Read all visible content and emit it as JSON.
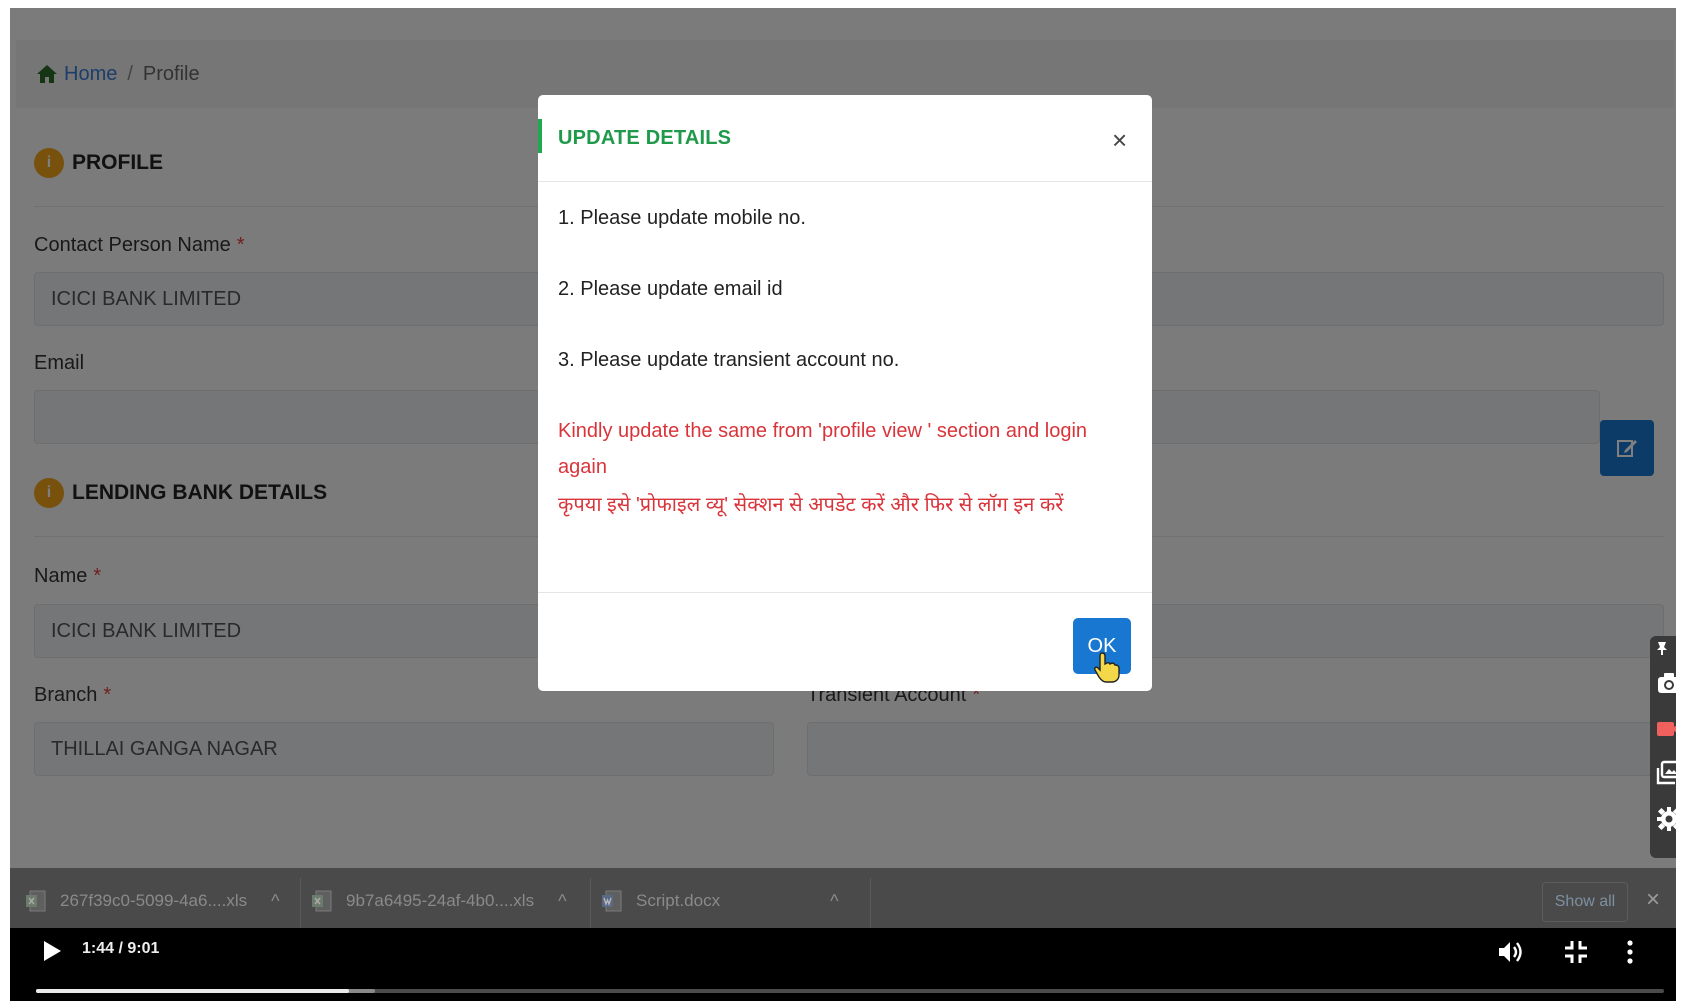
{
  "breadcrumb": {
    "home": "Home",
    "separator": "/",
    "current": "Profile"
  },
  "profile": {
    "section_badge": "i",
    "section_title": "PROFILE",
    "contact_label": "Contact Person Name",
    "contact_value": "ICICI BANK LIMITED",
    "email_label": "Email",
    "email_value": ""
  },
  "lending": {
    "section_badge": "i",
    "section_title": "LENDING BANK DETAILS",
    "name_label": "Name",
    "name_value": "ICICI BANK LIMITED",
    "branch_label": "Branch",
    "branch_value": "THILLAI GANGA NAGAR",
    "transient_label": "Transient Account",
    "transient_value": ""
  },
  "required_mark": "*",
  "modal": {
    "title": "UPDATE DETAILS",
    "close": "×",
    "lines": [
      "1. Please update mobile no.",
      "2. Please update email id",
      "3. Please update transient account no."
    ],
    "notice_en_1": "Kindly update the same from 'profile view ' section and login",
    "notice_en_2": "again",
    "notice_hi": "कृपया इसे 'प्रोफाइल व्यू' सेक्शन से अपडेट करें और फिर से लॉग इन करें",
    "ok_label": "OK"
  },
  "downloads": {
    "items": [
      {
        "name": "267f39c0-5099-4a6....xls",
        "icon": "excel-file-icon"
      },
      {
        "name": "9b7a6495-24af-4b0....xls",
        "icon": "excel-file-icon"
      },
      {
        "name": "Script.docx",
        "icon": "word-file-icon"
      }
    ],
    "chevron": "^",
    "show_all": "Show all",
    "close": "×"
  },
  "video": {
    "time": "1:44 / 9:01",
    "played_fraction": 0.192,
    "buffered_fraction": 0.208
  },
  "side_toolbar": {
    "icons": [
      "pin-icon",
      "camera-icon",
      "record-icon",
      "gallery-icon",
      "settings-icon"
    ]
  },
  "colors": {
    "primary": "#1877d0",
    "title_green": "#1f9a4a",
    "notice_red": "#d9343a",
    "badge_orange": "#f0a21a"
  }
}
